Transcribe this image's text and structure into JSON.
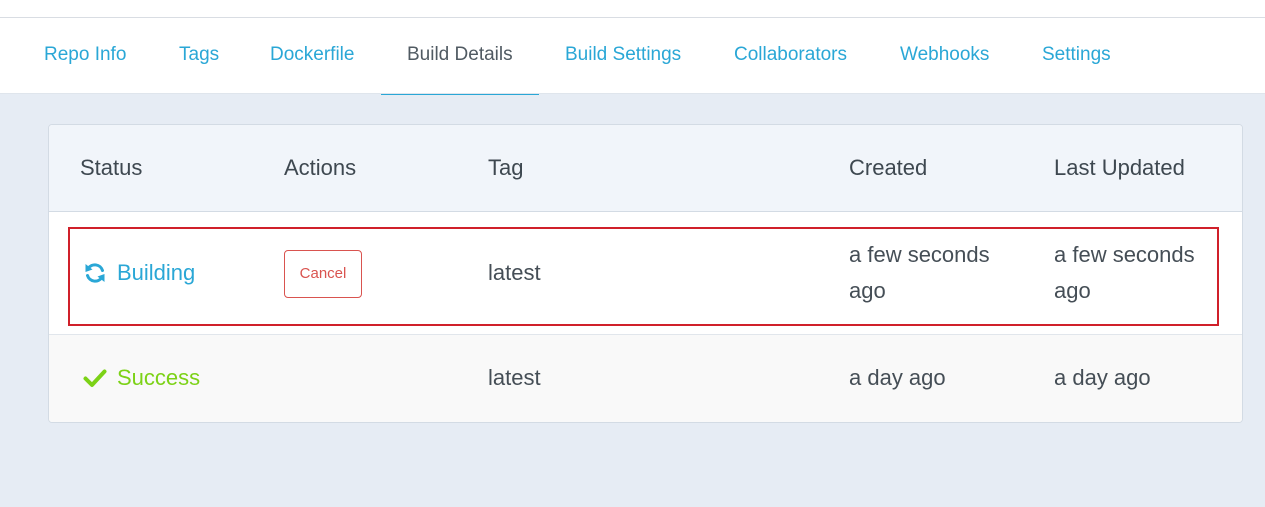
{
  "tabs": [
    {
      "label": "Repo Info"
    },
    {
      "label": "Tags"
    },
    {
      "label": "Dockerfile"
    },
    {
      "label": "Build Details",
      "active": true
    },
    {
      "label": "Build Settings"
    },
    {
      "label": "Collaborators"
    },
    {
      "label": "Webhooks"
    },
    {
      "label": "Settings"
    }
  ],
  "table": {
    "headers": [
      "Status",
      "Actions",
      "Tag",
      "Created",
      "Last Updated"
    ],
    "rows": [
      {
        "status": "Building",
        "status_icon": "refresh-icon",
        "action": "Cancel",
        "tag": "latest",
        "created": "a few seconds ago",
        "last_updated": "a few seconds ago",
        "highlighted": true
      },
      {
        "status": "Success",
        "status_icon": "check-icon",
        "action": "",
        "tag": "latest",
        "created": "a day ago",
        "last_updated": "a day ago",
        "highlighted": false
      }
    ]
  },
  "colors": {
    "link": "#2aa7d6",
    "building": "#2aa7d6",
    "success": "#7cd217",
    "cancel": "#d9534f",
    "highlight": "#d0202a"
  }
}
